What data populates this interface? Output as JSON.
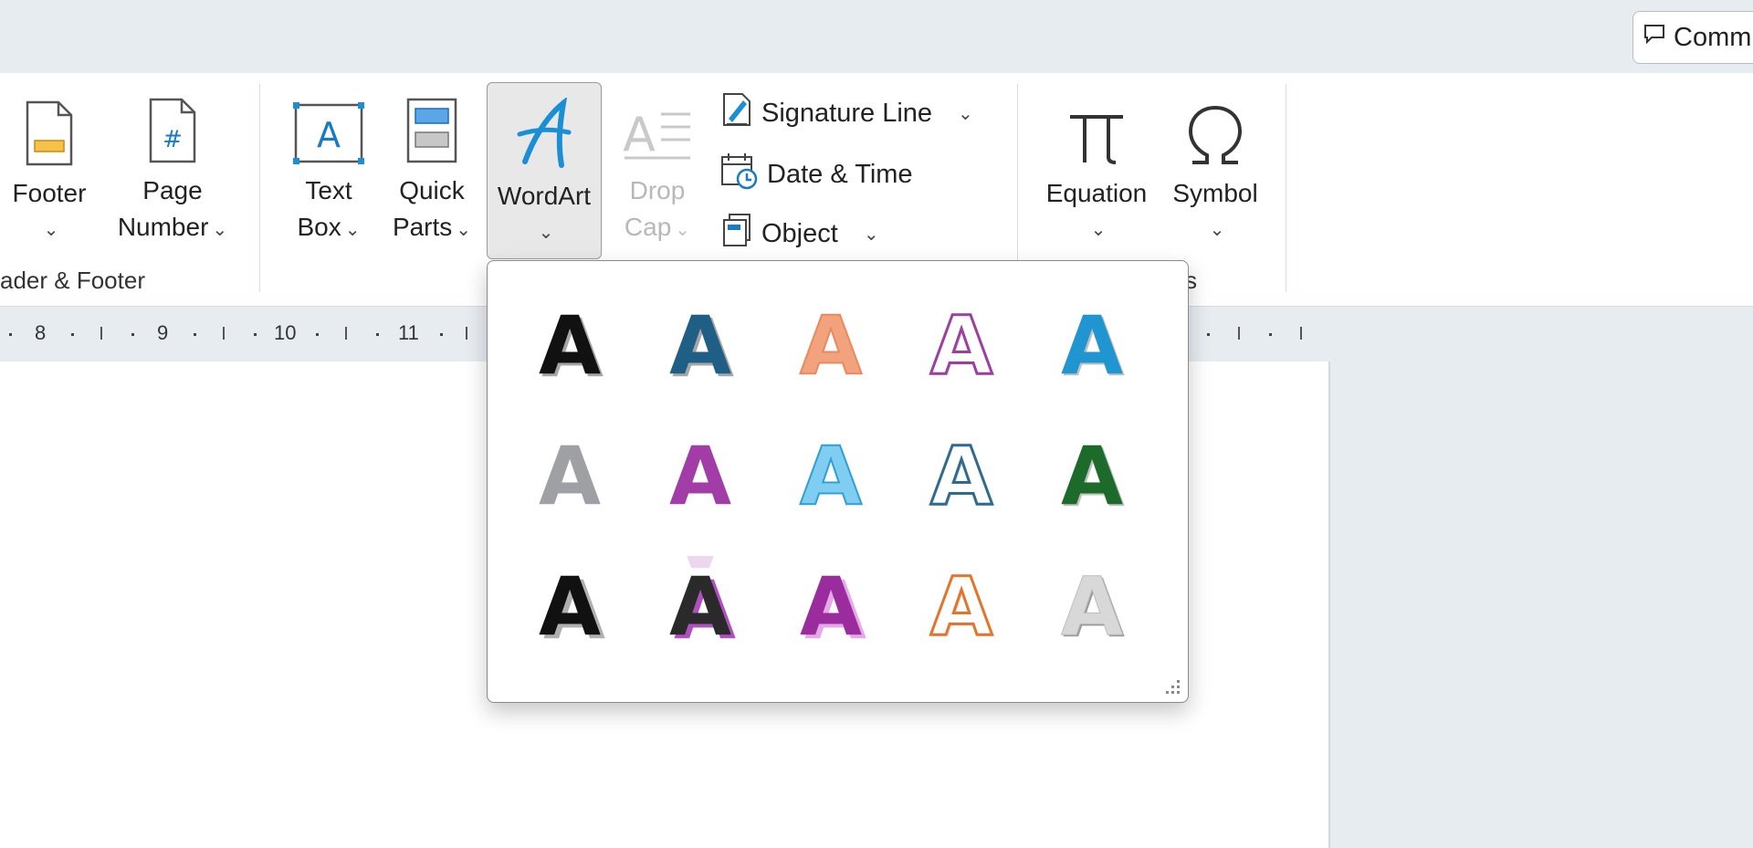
{
  "top_bar": {
    "comments_label": "Comm"
  },
  "ribbon": {
    "header_footer_group": {
      "label": "ader & Footer",
      "footer_label": "Footer",
      "page_number_line1": "Page",
      "page_number_line2": "Number"
    },
    "text_group": {
      "textbox_line1": "Text",
      "textbox_line2": "Box",
      "quickparts_line1": "Quick",
      "quickparts_line2": "Parts",
      "wordart_label": "WordArt",
      "dropcap_line1": "Drop",
      "dropcap_line2": "Cap",
      "signature_line": "Signature Line",
      "date_time": "Date & Time",
      "object": "Object"
    },
    "symbols_group": {
      "label": "s",
      "equation": "Equation",
      "symbol": "Symbol"
    }
  },
  "ruler": {
    "numbers": [
      "8",
      "9",
      "10",
      "11"
    ]
  },
  "wordart_gallery": {
    "styles": [
      {
        "name": "fill-black-shadow",
        "fill": "#111111",
        "stroke": "none",
        "effect": "shadow"
      },
      {
        "name": "fill-blue-accent1-shadow",
        "fill": "#1f5f86",
        "stroke": "none",
        "effect": "shadow"
      },
      {
        "name": "fill-orange-accent2-outline",
        "fill": "#f2a37e",
        "stroke": "#e88a5c",
        "effect": "soft"
      },
      {
        "name": "fill-white-outline-purple",
        "fill": "#ffffff",
        "stroke": "#9b3fa0",
        "effect": "outline"
      },
      {
        "name": "fill-blue-gradient",
        "fill": "#1f96d0",
        "stroke": "none",
        "effect": "bevel"
      },
      {
        "name": "fill-gray-accent",
        "fill": "#9ea0a4",
        "stroke": "none",
        "effect": "plain"
      },
      {
        "name": "fill-purple-reflection",
        "fill": "#a23ca6",
        "stroke": "none",
        "effect": "reflection"
      },
      {
        "name": "fill-light-blue",
        "fill": "#7fcdf1",
        "stroke": "#2fa0d6",
        "effect": "soft"
      },
      {
        "name": "fill-white-outline-blue",
        "fill": "#ffffff",
        "stroke": "#2e6b8e",
        "effect": "outline"
      },
      {
        "name": "fill-green-bevel",
        "fill": "#1d6b2a",
        "stroke": "none",
        "effect": "bevel"
      },
      {
        "name": "fill-black-shadow-offset",
        "fill": "#111111",
        "stroke": "none",
        "effect": "offset-gray"
      },
      {
        "name": "fill-black-purple-offset",
        "fill": "#2a2a2a",
        "stroke": "none",
        "effect": "offset-purple"
      },
      {
        "name": "fill-purple-offset",
        "fill": "#9b2c9d",
        "stroke": "none",
        "effect": "offset-light"
      },
      {
        "name": "fill-white-outline-orange",
        "fill": "#ffffff",
        "stroke": "#e4742c",
        "effect": "outline"
      },
      {
        "name": "fill-silver-gradient",
        "fill": "#d8d8d8",
        "stroke": "none",
        "effect": "silver"
      }
    ]
  }
}
